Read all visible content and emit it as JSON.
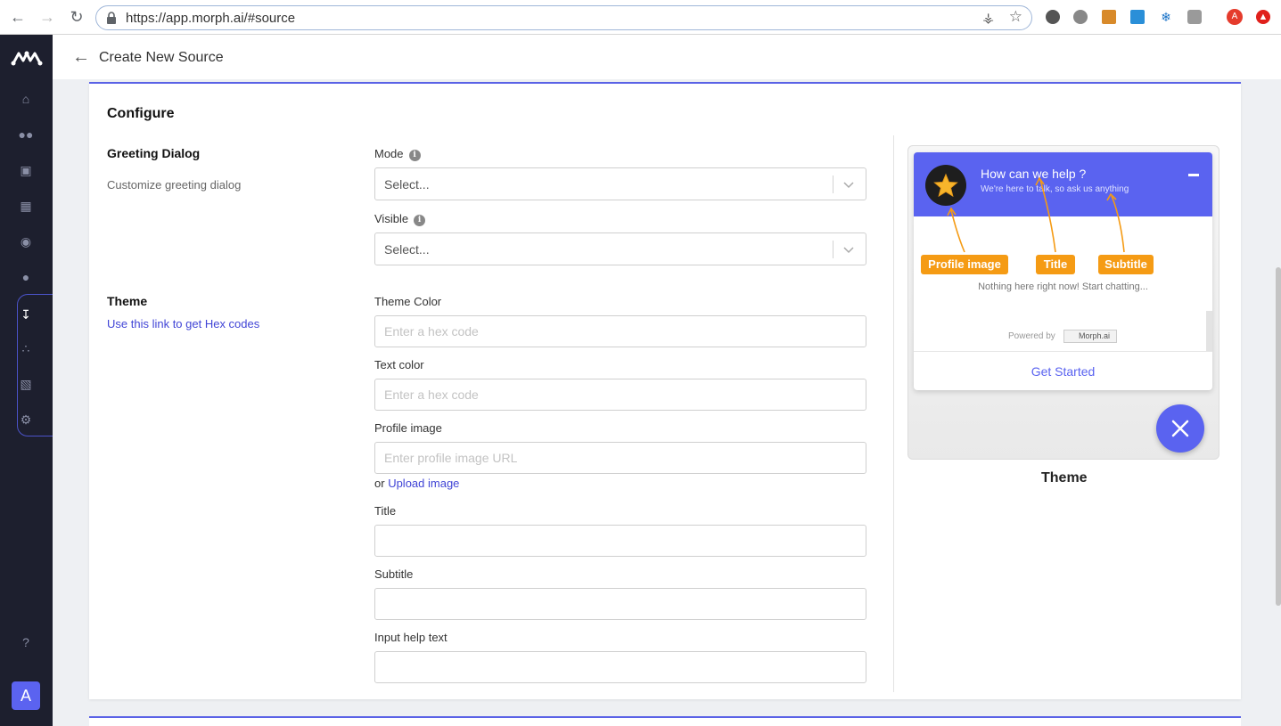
{
  "browser": {
    "url": "https://app.morph.ai/#source",
    "profile_initial": "A"
  },
  "header": {
    "title": "Create New Source"
  },
  "configure": {
    "title": "Configure",
    "greeting": {
      "title": "Greeting Dialog",
      "description": "Customize greeting dialog",
      "mode_label": "Mode",
      "mode_placeholder": "Select...",
      "visible_label": "Visible",
      "visible_placeholder": "Select..."
    },
    "theme": {
      "title": "Theme",
      "hex_link": "Use this link to get Hex codes",
      "theme_color_label": "Theme Color",
      "theme_color_placeholder": "Enter a hex code",
      "text_color_label": "Text color",
      "text_color_placeholder": "Enter a hex code",
      "profile_image_label": "Profile image",
      "profile_image_placeholder": "Enter profile image URL",
      "or_text": "or",
      "upload_link": "Upload image",
      "title_label": "Title",
      "subtitle_label": "Subtitle",
      "input_help_label": "Input help text"
    }
  },
  "preview": {
    "widget_title": "How can we help ?",
    "widget_subtitle": "We're here to talk, so ask us anything",
    "tag_profile": "Profile image",
    "tag_title": "Title",
    "tag_subtitle": "Subtitle",
    "empty_text": "Nothing here right now! Start chatting...",
    "powered_by": "Powered by",
    "brand": "Morph.ai",
    "cta": "Get Started",
    "caption": "Theme"
  },
  "sidebar": {
    "user_initial": "A"
  },
  "colors": {
    "accent": "#5a63f0",
    "tag": "#f59b14",
    "sidebar": "#1d1f2e"
  }
}
